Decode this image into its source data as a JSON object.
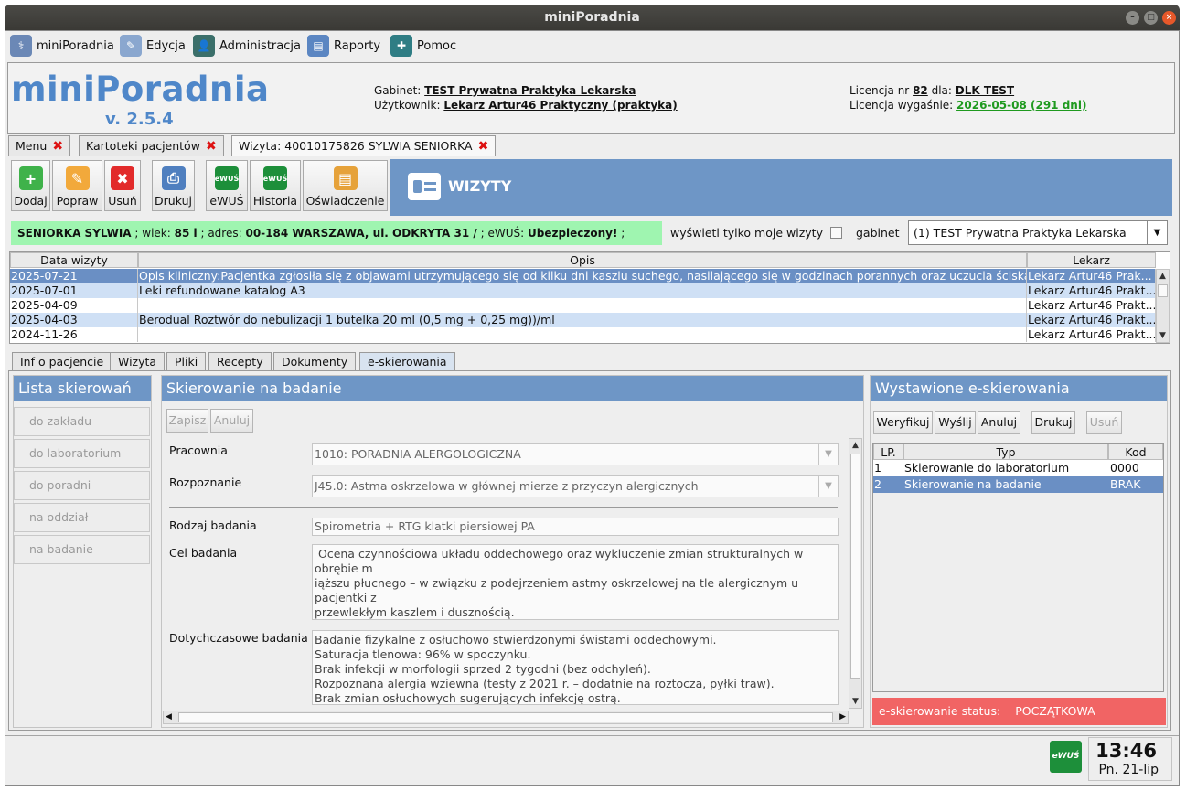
{
  "window": {
    "title": "miniPoradnia"
  },
  "menu": [
    {
      "label": "miniPoradnia",
      "icon": "doctor-icon"
    },
    {
      "label": "Edycja",
      "icon": "edit-icon"
    },
    {
      "label": "Administracja",
      "icon": "admin-icon"
    },
    {
      "label": "Raporty",
      "icon": "reports-icon"
    },
    {
      "label": "Pomoc",
      "icon": "help-icon"
    }
  ],
  "header": {
    "brand": "miniPoradnia",
    "version": "v. 2.5.4",
    "gabinet_label": "Gabinet:",
    "gabinet": "TEST Prywatna Praktyka Lekarska",
    "user_label": "Użytkownik:",
    "user": "Lekarz Artur46 Praktyczny (praktyka)",
    "licence_label": "Licencja nr",
    "licence_nr": "82",
    "licence_for": "dla:",
    "licence_holder": "DLK TEST",
    "expiry_label": "Licencja wygaśnie:",
    "expiry": "2026-05-08 (291 dni)"
  },
  "top_tabs": [
    "Menu",
    "Kartoteki pacjentów",
    "Wizyta: 40010175826 SYLWIA SENIORKA"
  ],
  "toolbar": {
    "dodaj": "Dodaj",
    "popraw": "Popraw",
    "usun": "Usuń",
    "drukuj": "Drukuj",
    "ewus": "eWUŚ",
    "historia": "Historia",
    "oswiadczenie": "Oświadczenie",
    "ewus_badge": "eWUŚ"
  },
  "banner": {
    "title": "WIZYTY"
  },
  "patient": {
    "name": "SENIORKA SYLWIA",
    "age_label": "; wiek:",
    "age": "85 l",
    "addr_label": "; adres:",
    "address": "00-184 WARSZAWA, ul. ODKRYTA 31 /",
    "ewus_label": "; eWUŚ:",
    "ewus": "Ubezpieczony!",
    "tail": ";"
  },
  "filter": {
    "only_mine": "wyświetl tylko moje wizyty",
    "gabinet_label": "gabinet",
    "gabinet_value": "(1) TEST Prywatna Praktyka Lekarska"
  },
  "visits": {
    "columns": [
      "Data wizyty",
      "Opis",
      "Lekarz"
    ],
    "rows": [
      {
        "date": "2025-07-21",
        "desc": "Opis kliniczny:Pacjentka zgłosiła się z objawami utrzymującego się od kilku dni kaszlu suchego, nasilającego się w godzinach porannych oraz uczucia ściskani...",
        "doctor": "Lekarz Artur46 Prak..."
      },
      {
        "date": "2025-07-01",
        "desc": "Leki refundowane katalog A3",
        "doctor": "Lekarz Artur46 Prakt..."
      },
      {
        "date": "2025-04-09",
        "desc": "",
        "doctor": "Lekarz Artur46 Prakt..."
      },
      {
        "date": "2025-04-03",
        "desc": "Berodual   Roztwór do nebulizacji  1 butelka 20 ml  (0,5 mg + 0,25 mg))/ml",
        "doctor": "Lekarz Artur46 Prakt..."
      },
      {
        "date": "2024-11-26",
        "desc": "",
        "doctor": "Lekarz Artur46 Prakt..."
      }
    ]
  },
  "bottom_tabs": [
    "Inf o pacjencie",
    "Wizyta",
    "Pliki",
    "Recepty",
    "Dokumenty",
    "e-skierowania"
  ],
  "referral_list": {
    "title": "Lista skierowań",
    "items": [
      "do zakładu",
      "do laboratorium",
      "do poradni",
      "na oddział",
      "na badanie"
    ]
  },
  "form": {
    "title": "Skierowanie na badanie",
    "save": "Zapisz",
    "cancel": "Anuluj",
    "pracownia_label": "Pracownia",
    "pracownia": "1010: PORADNIA ALERGOLOGICZNA",
    "rozpoznanie_label": "Rozpoznanie",
    "rozpoznanie": "J45.0: Astma oskrzelowa w głównej mierze z przyczyn alergicznych",
    "rodzaj_label": "Rodzaj badania",
    "rodzaj": "Spirometria + RTG klatki piersiowej PA",
    "cel_label": "Cel badania",
    "cel": " Ocena czynnościowa układu oddechowego oraz wykluczenie zmian strukturalnych w obrębie m\niąższu płucnego – w związku z podejrzeniem astmy oskrzelowej na tle alergicznym u pacjentki z\nprzewlekłym kaszlem i dusznością.",
    "dotych_label": "Dotychczasowe badania",
    "dotych": "Badanie fizykalne z osłuchowo stwierdzonymi świstami oddechowymi.\nSaturacja tlenowa: 96% w spoczynku.\nBrak infekcji w morfologii sprzed 2 tygodni (bez odchyleń).\nRozpoznana alergia wziewna (testy z 2021 r. – dodatnie na roztocza, pyłki traw).\nBrak zmian osłuchowych sugerujących infekcję ostrą."
  },
  "issued": {
    "title": "Wystawione e-skierowania",
    "buttons": {
      "verify": "Weryfikuj",
      "send": "Wyślij",
      "cancel": "Anuluj",
      "print": "Drukuj",
      "delete": "Usuń"
    },
    "columns": [
      "LP.",
      "Typ",
      "Kod"
    ],
    "rows": [
      {
        "lp": "1",
        "type": "Skierowanie do laboratorium",
        "code": "0000"
      },
      {
        "lp": "2",
        "type": "Skierowanie na badanie",
        "code": "BRAK"
      }
    ],
    "status_label": "e-skierowanie status:",
    "status": "POCZĄTKOWA"
  },
  "clock": {
    "time": "13:46",
    "date": "Pn. 21-lip",
    "badge": "eWUŚ"
  },
  "colors": {
    "accent": "#6e96c6",
    "brand": "#4f87c9",
    "patient_bg": "#9ff5b0",
    "selected_row": "#6a8fc4",
    "status_bg": "#f16464",
    "expiry": "#1f9a1f"
  }
}
